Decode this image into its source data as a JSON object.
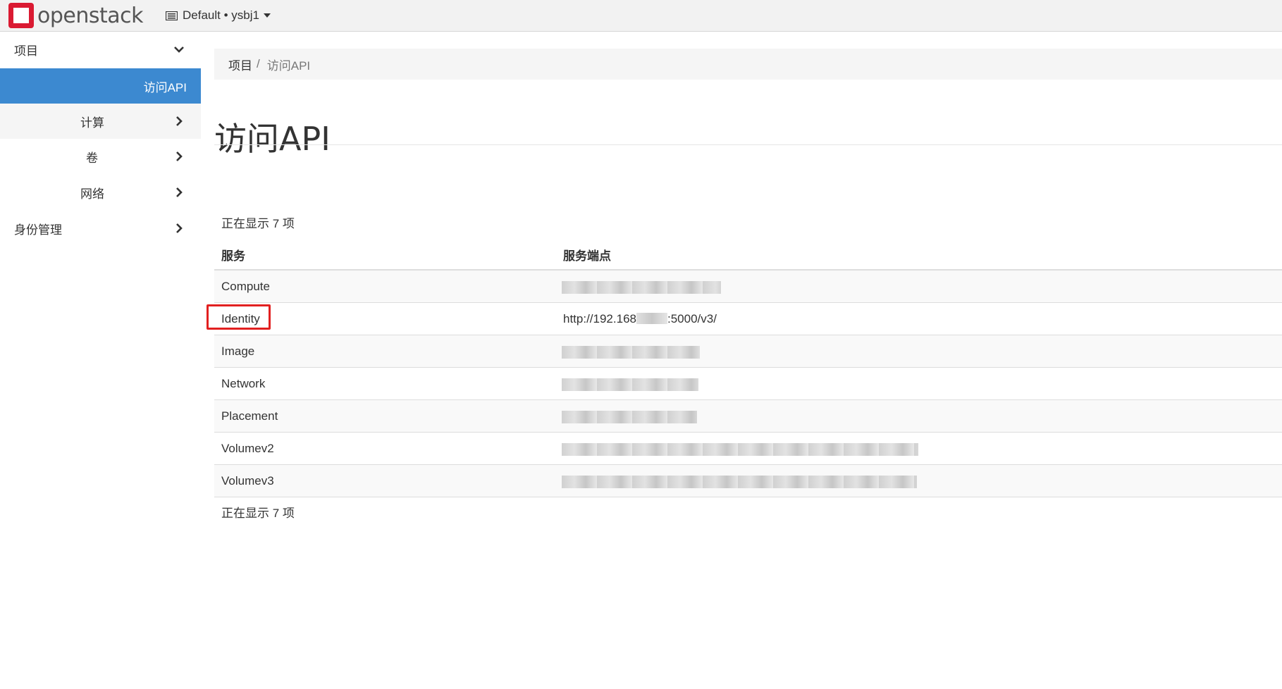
{
  "header": {
    "brand": "openstack",
    "project_switcher": "Default • ysbj1"
  },
  "sidebar": {
    "project": "项目",
    "access_api": "访问API",
    "compute": "计算",
    "volume": "卷",
    "network": "网络",
    "identity": "身份管理"
  },
  "breadcrumb": {
    "root": "项目",
    "separator": "/",
    "current": "访问API"
  },
  "page": {
    "title": "访问API",
    "count_label": "正在显示 7 项"
  },
  "table": {
    "headers": {
      "service": "服务",
      "endpoint": "服务端点"
    },
    "rows": [
      {
        "service": "Compute",
        "endpoint": ""
      },
      {
        "service": "Identity",
        "endpoint_prefix": "http://192.168",
        "endpoint_suffix": ":5000/v3/"
      },
      {
        "service": "Image",
        "endpoint": ""
      },
      {
        "service": "Network",
        "endpoint": ""
      },
      {
        "service": "Placement",
        "endpoint": ""
      },
      {
        "service": "Volumev2",
        "endpoint": ""
      },
      {
        "service": "Volumev3",
        "endpoint": ""
      }
    ]
  },
  "colors": {
    "active_nav": "#3c89d0",
    "brand_red": "#da1a32",
    "highlight_box": "#e22020"
  }
}
